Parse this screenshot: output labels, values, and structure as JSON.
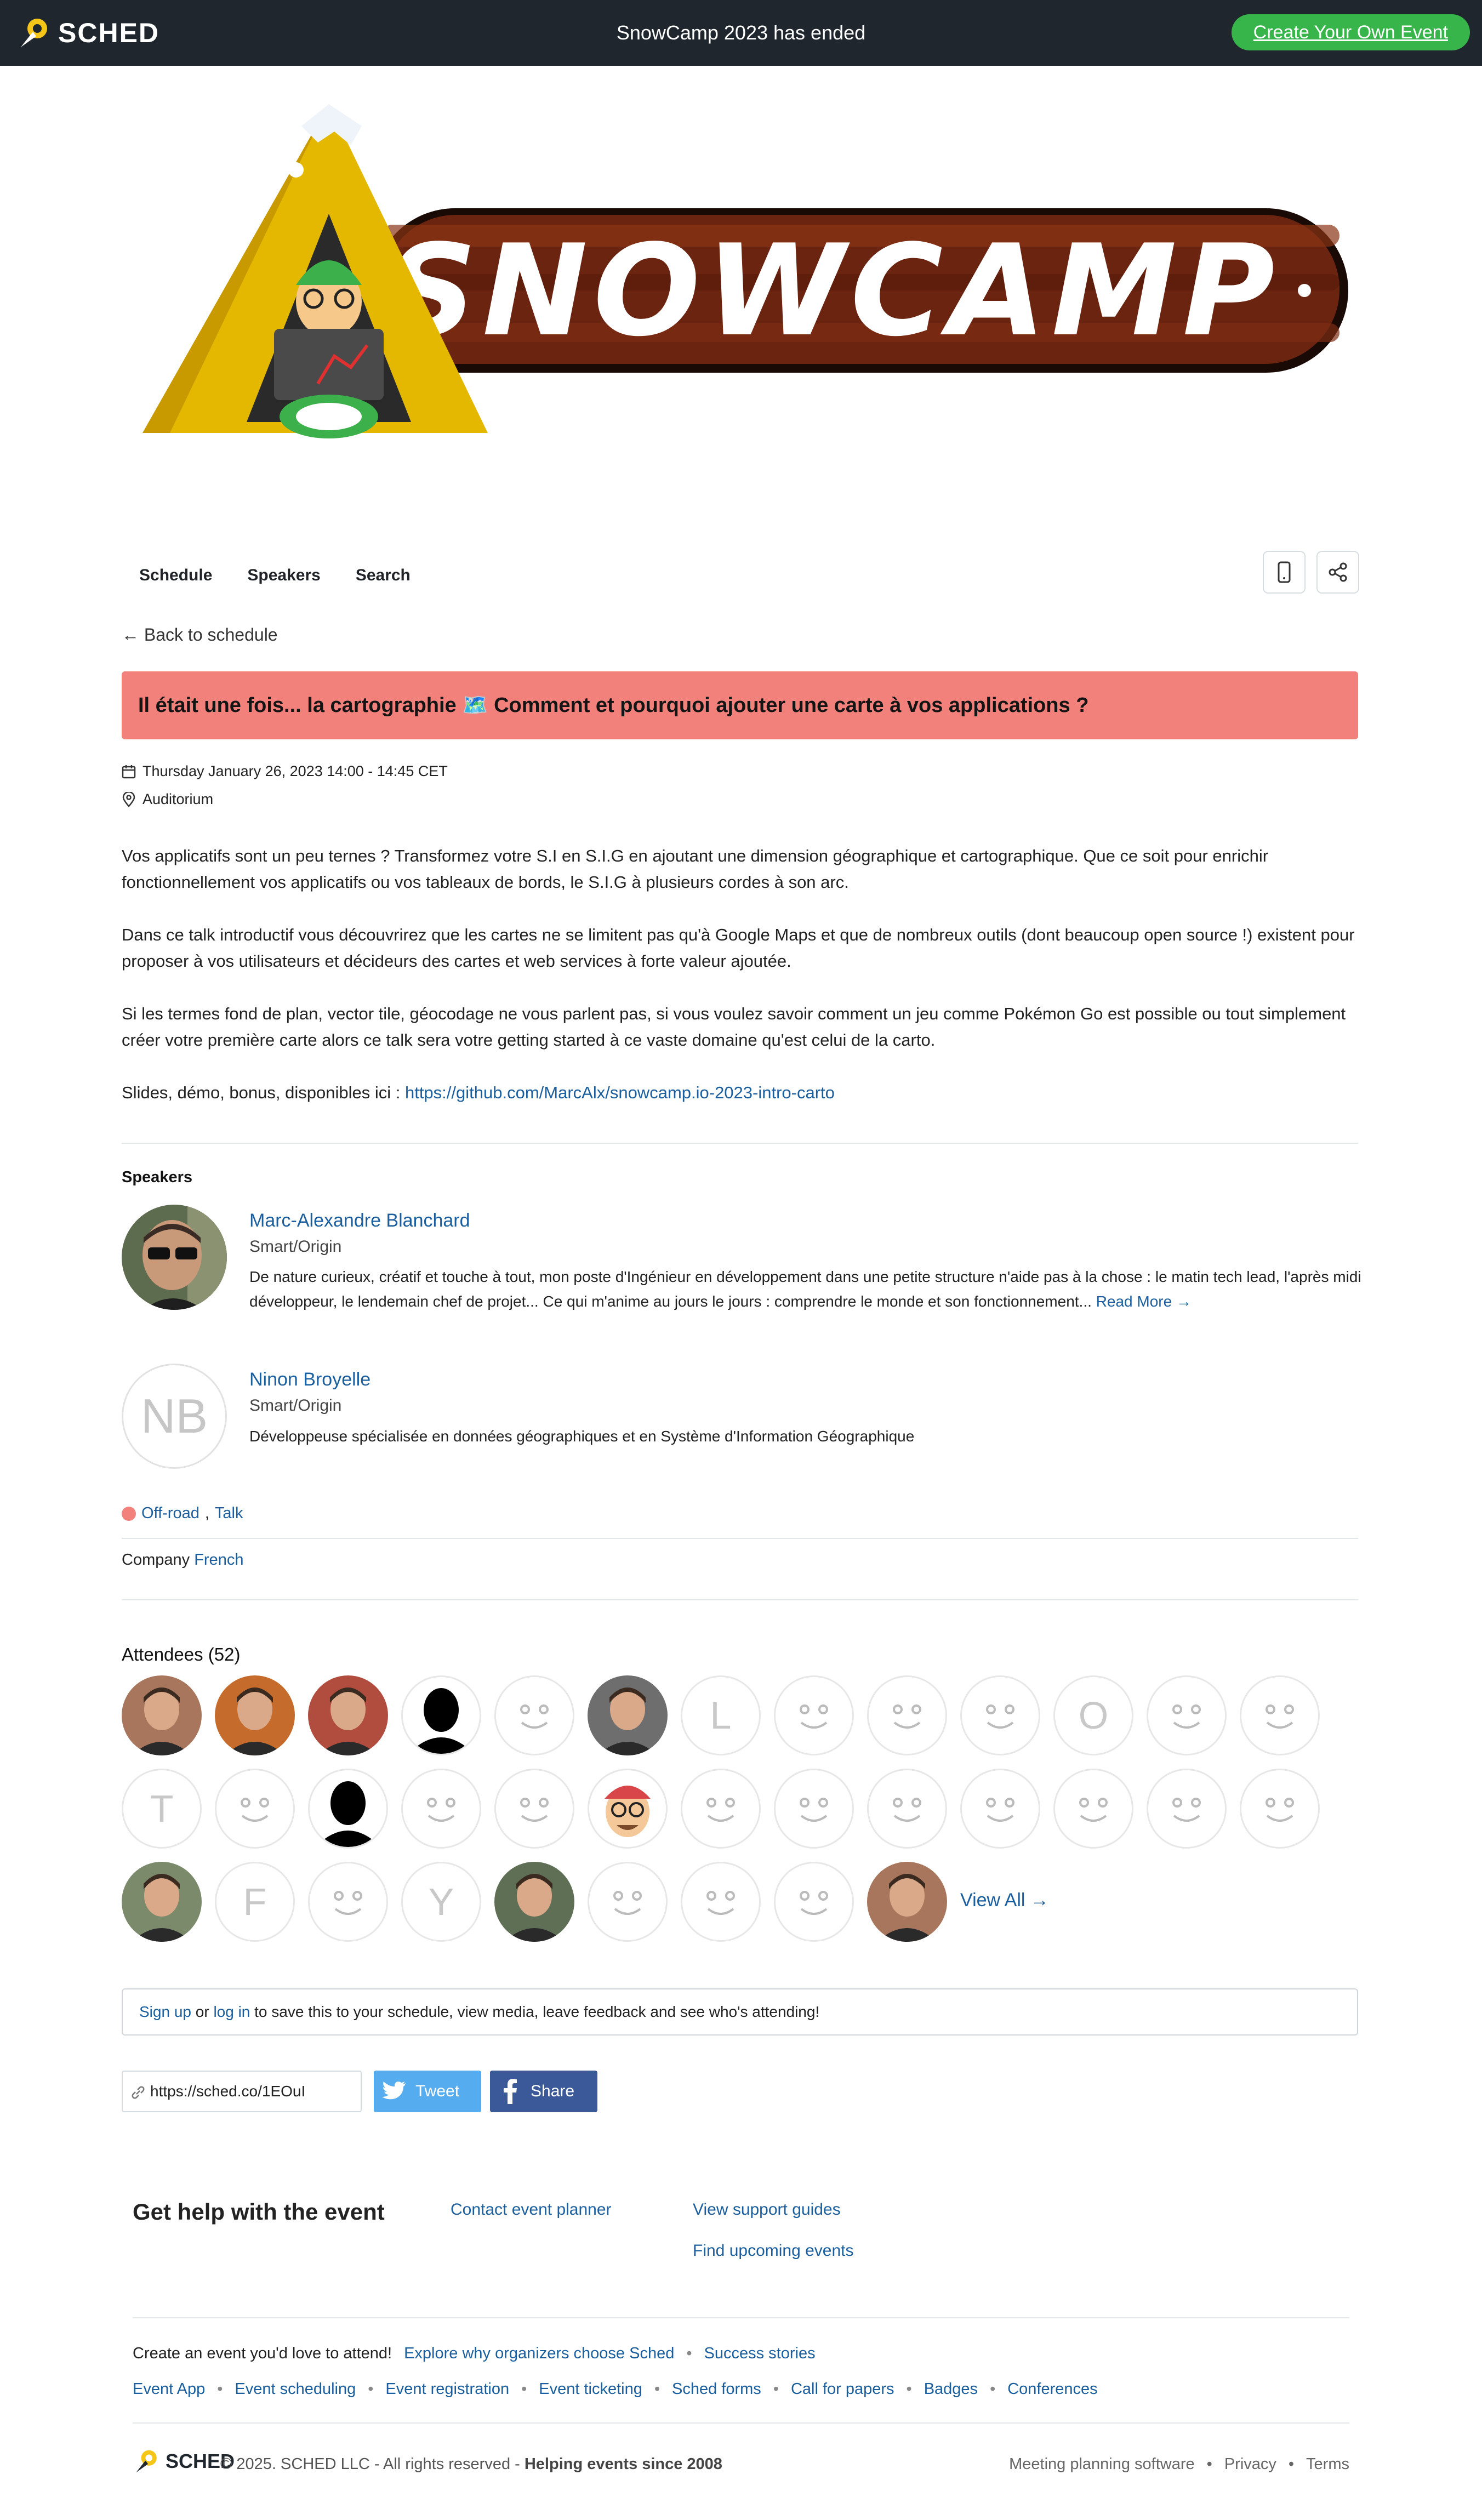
{
  "topbar": {
    "brand": "SCHED",
    "event_name": "SnowCamp 2023",
    "status_suffix": "has ended",
    "cta": "Create Your Own Event"
  },
  "banner": {
    "logo_text": "SNOWCAMP"
  },
  "nav": {
    "items": [
      "Schedule",
      "Speakers",
      "Search"
    ]
  },
  "back_link": "← Back to schedule",
  "session": {
    "title": "Il était une fois... la cartographie 🗺️ Comment et pourquoi ajouter une carte à vos applications ?",
    "datetime": "Thursday January 26, 2023 14:00 - 14:45 CET",
    "location": "Auditorium",
    "description": [
      "Vos applicatifs sont un peu ternes ? Transformez votre S.I en S.I.G en ajoutant une dimension géographique et cartographique. Que ce soit pour enrichir fonctionnellement vos applicatifs ou vos tableaux de bords, le S.I.G à plusieurs cordes à son arc.",
      "Dans ce talk introductif vous découvrirez que les cartes ne se limitent pas qu'à Google Maps et que de nombreux outils (dont beaucoup open source !) existent pour proposer à vos utilisateurs et décideurs des cartes et web services à forte valeur ajoutée.",
      "Si les termes fond de plan, vector tile, géocodage ne vous parlent pas, si vous voulez savoir comment un jeu comme Pokémon Go est possible ou tout simplement créer votre première carte alors ce talk sera votre getting started à ce vaste domaine qu'est celui de la carto."
    ],
    "slides_label": "Slides, démo, bonus, disponibles ici :",
    "slides_url": "https://github.com/MarcAlx/snowcamp.io-2023-intro-carto"
  },
  "speakers": {
    "heading": "Speakers",
    "list": [
      {
        "name": "Marc-Alexandre Blanchard",
        "company": "Smart/Origin",
        "bio": "De nature curieux, créatif et touche à tout, mon poste d'Ingénieur en développement dans une petite structure n'aide pas à la chose : le matin tech lead, l'après midi développeur, le lendemain chef de projet... Ce qui m'anime au jours le jours : comprendre le monde et son fonctionnement...",
        "read_more": "Read More →"
      },
      {
        "name": "Ninon Broyelle",
        "company": "Smart/Origin",
        "initials": "NB",
        "bio": "Développeuse spécialisée en données géographiques et en Système d'Information Géographique"
      }
    ]
  },
  "tags": {
    "type1": "Off-road",
    "type2": "Talk",
    "color": "#f2817c"
  },
  "company_row": {
    "label": "Company",
    "value": "French"
  },
  "attendees": {
    "heading": "Attendees (52)",
    "items": [
      "photo",
      "photo",
      "photo",
      "silhouette",
      "smiley",
      "photo",
      "L",
      "smiley",
      "smiley",
      "smiley",
      "O",
      "smiley",
      "smiley",
      "T",
      "smiley",
      "silhouette",
      "smiley",
      "smiley",
      "cartoon",
      "smiley",
      "smiley",
      "smiley",
      "smiley",
      "smiley",
      "smiley",
      "smiley",
      "photo",
      "F",
      "smiley",
      "Y",
      "photo",
      "smiley",
      "smiley",
      "smiley",
      "photo"
    ],
    "view_all": "View All →"
  },
  "signup": {
    "sign_up": "Sign up",
    "or": "or",
    "log_in": "log in",
    "rest": "to save this to your schedule, view media, leave feedback and see who's attending!"
  },
  "share": {
    "short_url": "https://sched.co/1EOuI",
    "tweet": "Tweet",
    "fb": "Share"
  },
  "footer": {
    "help_title": "Get help with the event",
    "contact": "Contact event planner",
    "guides": "View support guides",
    "upcoming": "Find upcoming events",
    "create_text": "Create an event you'd love to attend!",
    "explore": "Explore why organizers choose Sched",
    "success": "Success stories",
    "links": [
      "Event App",
      "Event scheduling",
      "Event registration",
      "Event ticketing",
      "Sched forms",
      "Call for papers",
      "Badges",
      "Conferences"
    ],
    "brand": "SCHED",
    "copyright": "© 2025. SCHED LLC - All rights reserved -",
    "tagline": "Helping events since 2008",
    "legal": [
      "Meeting planning software",
      "Privacy",
      "Terms"
    ]
  },
  "colors": {
    "accent": "#1a5e9e",
    "title_bg": "#f2817c",
    "topbar": "#1f262d",
    "cta": "#38b54a"
  }
}
